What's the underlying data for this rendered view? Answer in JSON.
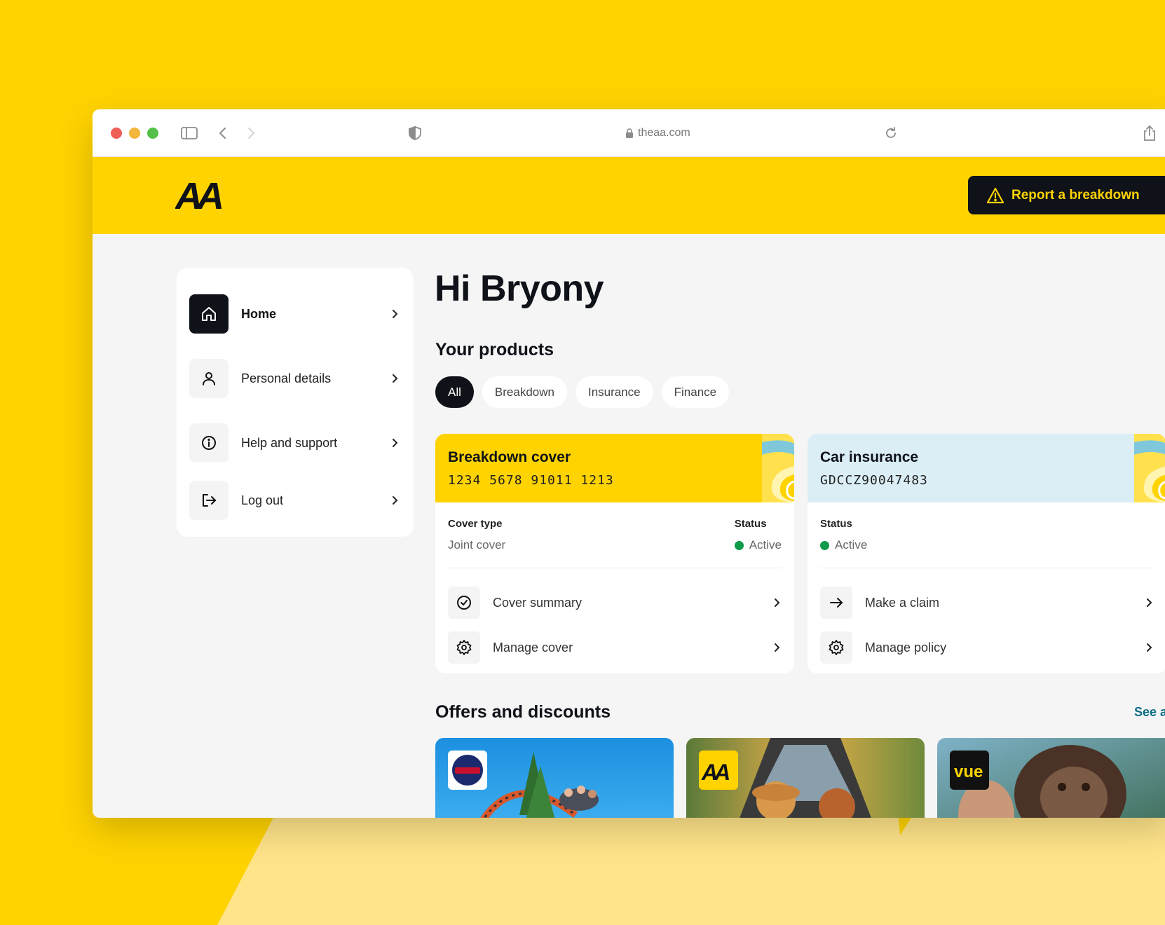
{
  "browser": {
    "url": "theaa.com"
  },
  "header": {
    "logo_text": "AA",
    "report_button": "Report a breakdown"
  },
  "sidebar": {
    "items": [
      {
        "label": "Home",
        "icon": "home-icon"
      },
      {
        "label": "Personal details",
        "icon": "user-icon"
      },
      {
        "label": "Help and support",
        "icon": "info-icon"
      },
      {
        "label": "Log out",
        "icon": "logout-icon"
      }
    ]
  },
  "main": {
    "greeting": "Hi Bryony",
    "products_title": "Your products",
    "filters": [
      "All",
      "Breakdown",
      "Insurance",
      "Finance"
    ],
    "cards": [
      {
        "title": "Breakdown cover",
        "number": "1234 5678 91011 1213",
        "cover_type_label": "Cover type",
        "cover_type_value": "Joint cover",
        "status_label": "Status",
        "status_value": "Active",
        "actions": [
          "Cover summary",
          "Manage cover"
        ]
      },
      {
        "title": "Car insurance",
        "number": "GDCCZ90047483",
        "status_label": "Status",
        "status_value": "Active",
        "actions": [
          "Make a claim",
          "Manage policy"
        ]
      }
    ],
    "offers_title": "Offers and discounts",
    "see_all": "See all",
    "offers": [
      {
        "brand": "Alton Towers"
      },
      {
        "brand": "AA"
      },
      {
        "brand": "vue"
      }
    ]
  },
  "colors": {
    "brand_yellow": "#FFD300",
    "dark": "#0f1218",
    "insurance_blue": "#dbeef6",
    "status_green": "#0e9a4a",
    "link": "#0b6f86"
  }
}
